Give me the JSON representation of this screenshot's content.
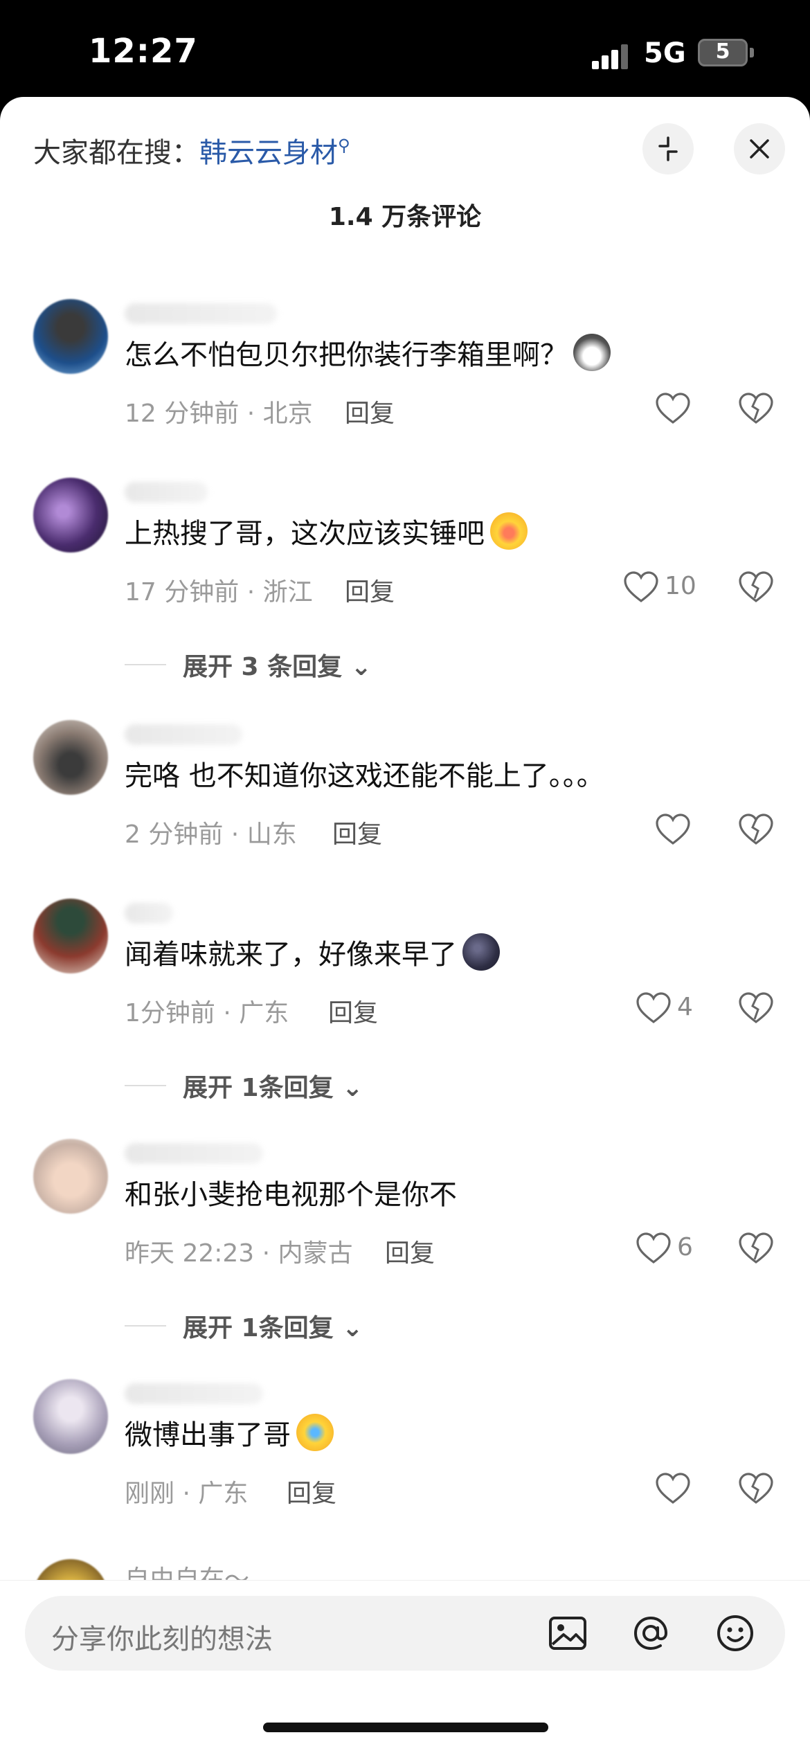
{
  "status_bar": {
    "time": "12:27",
    "network": "5G",
    "battery": "5"
  },
  "header": {
    "hot_search_prefix": "大家都在搜：",
    "hot_search_keyword": "韩云云身材",
    "comment_count": "1.4 万条评论"
  },
  "comments": [
    {
      "text": "怎么不怕包贝尔把你装行李箱里啊？",
      "time": "12 分钟前",
      "location": "北京",
      "reply": "回复",
      "likes": "",
      "emoji": "husky"
    },
    {
      "text": "上热搜了哥，这次应该实锤吧",
      "time": "17 分钟前",
      "location": "浙江",
      "reply": "回复",
      "likes": "10",
      "emoji": "laugh-cry",
      "expand": "展开 3 条回复"
    },
    {
      "text": "完咯 也不知道你这戏还能不能上了。。。",
      "time": "2 分钟前",
      "location": "山东",
      "reply": "回复",
      "likes": ""
    },
    {
      "text": "闻着味就来了，好像来早了",
      "time": "1分钟前",
      "location": "广东",
      "reply": "回复",
      "likes": "4",
      "emoji": "dark-moon",
      "expand": "展开 1条回复"
    },
    {
      "text": "和张小斐抢电视那个是你不",
      "time": "昨天 22:23",
      "location": "内蒙古",
      "reply": "回复",
      "likes": "6",
      "expand": "展开 1条回复"
    },
    {
      "text": "微博出事了哥",
      "time": "刚刚",
      "location": "广东",
      "reply": "回复",
      "likes": "",
      "emoji": "crying"
    }
  ],
  "partial_comment_username": "自由自在～",
  "input": {
    "placeholder": "分享你此刻的想法"
  },
  "icons": [
    "shrink-icon",
    "close-icon",
    "heart-icon",
    "broken-heart-icon",
    "chevron-down-icon",
    "image-icon",
    "at-icon",
    "smiley-icon"
  ]
}
